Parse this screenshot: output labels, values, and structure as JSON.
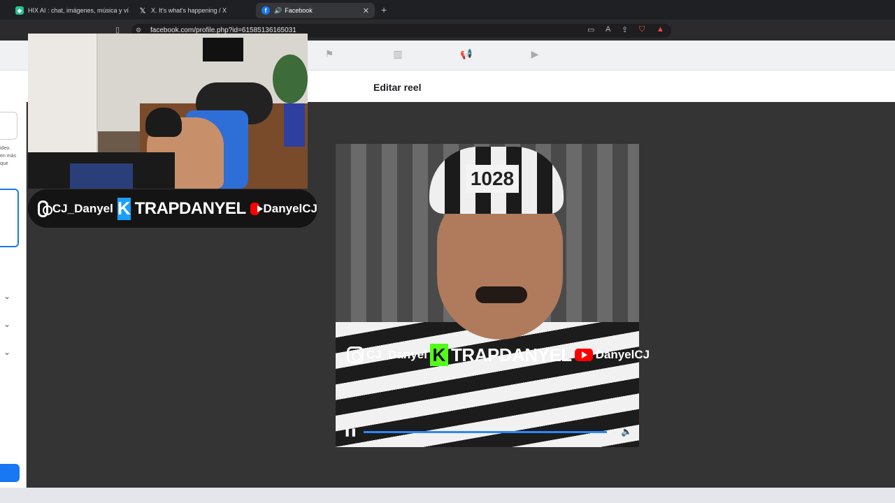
{
  "browser": {
    "tabs": [
      {
        "label": "HIX AI : chat, imágenes, música y víde",
        "icon": "hix-icon",
        "color": "#22c38e",
        "active": false
      },
      {
        "label": "X. It's what's happening / X",
        "icon": "x-icon",
        "color": "#000000",
        "active": false
      },
      {
        "label": "Facebook",
        "icon": "facebook-icon",
        "color": "#1877f2",
        "active": true
      }
    ],
    "url": "facebook.com/profile.php?id=61585136165031"
  },
  "modal": {
    "title": "Editar reel"
  },
  "left_panel": {
    "text_lines": [
      "ideo.",
      "en más",
      "que"
    ]
  },
  "webcam_overlay": {
    "instagram_handle": "CJ_Danyel",
    "kick_letter": "K",
    "kick_name": "TRAPDANYEL",
    "youtube_name": "DanyelCJ"
  },
  "video": {
    "cap_number": "1028",
    "overlay_instagram": "CJ_Danyel",
    "overlay_kick_letter": "K",
    "overlay_kick": "TRAPDANYEL",
    "overlay_youtube": "DanyelCJ",
    "progress_percent": 99,
    "state": "playing"
  },
  "colors": {
    "facebook_blue": "#1877f2",
    "kick_green": "#53fc18",
    "youtube_red": "#ff0000"
  }
}
